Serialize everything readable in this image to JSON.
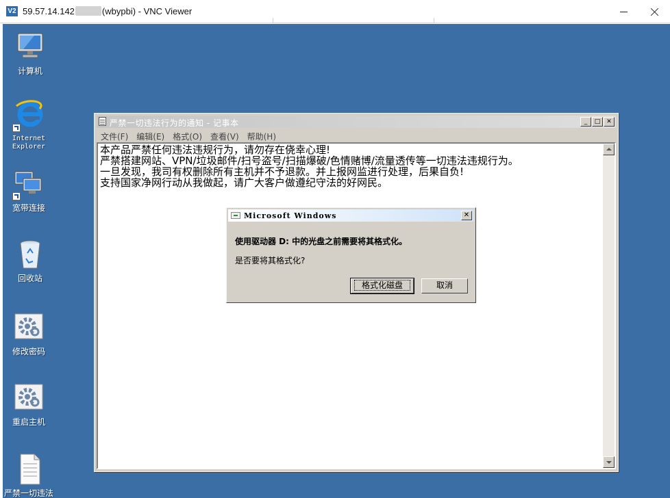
{
  "vnc": {
    "title_prefix": "59.57.14.142",
    "title_suffix": "(wbypbi) - VNC Viewer",
    "logo": "V2",
    "minimize_glyph": "",
    "close_glyph": ""
  },
  "desktop": {
    "background": "#3a6ea5",
    "icons": [
      {
        "label": "计算机",
        "icon": "computer-icon"
      },
      {
        "label": "Internet Explorer",
        "icon": "internet-explorer-icon"
      },
      {
        "label": "宽带连接",
        "icon": "network-connection-icon"
      },
      {
        "label": "回收站",
        "icon": "recycle-bin-icon"
      },
      {
        "label": "修改密码",
        "icon": "settings-gear-icon"
      },
      {
        "label": "重启主机",
        "icon": "settings-gear-icon"
      },
      {
        "label": "严禁一切违法行为的通知",
        "icon": "text-document-icon"
      }
    ]
  },
  "notepad": {
    "title": "严禁一切违法行为的通知 - 记事本",
    "menu": [
      "文件(F)",
      "编辑(E)",
      "格式(O)",
      "查看(V)",
      "帮助(H)"
    ],
    "lines": [
      "本产品严禁任何违法违规行为，请勿存在侥幸心理!",
      "严禁搭建网站、VPN/垃圾邮件/扫号盗号/扫描爆破/色情赌博/流量透传等一切违法违规行为。",
      "一旦发现，我司有权删除所有主机并不予退款。并上报网监进行处理，后果自负!",
      "支持国家净网行动从我做起，请广大客户做遵纪守法的好网民。"
    ]
  },
  "dialog": {
    "title": "Microsoft Windows",
    "message": "使用驱动器 D: 中的光盘之前需要将其格式化。",
    "question": "是否要将其格式化?",
    "format_button": "格式化磁盘",
    "cancel_button": "取消"
  }
}
